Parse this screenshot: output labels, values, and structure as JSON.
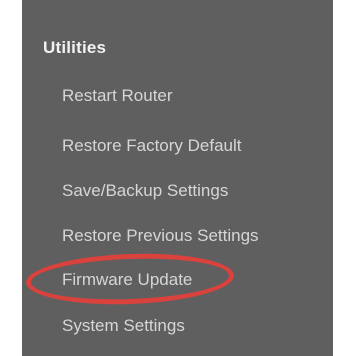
{
  "sidebar": {
    "title": "Utilities",
    "items": [
      {
        "label": "Restart Router"
      },
      {
        "label": "Restore Factory Default"
      },
      {
        "label": "Save/Backup Settings"
      },
      {
        "label": "Restore Previous Settings"
      },
      {
        "label": "Firmware Update",
        "highlighted": true
      },
      {
        "label": "System Settings"
      }
    ]
  },
  "colors": {
    "panel_background": "#5f5f5f",
    "title_text": "#f2f2f2",
    "item_text": "#d6d6d6",
    "highlight_annotation": "#d9423d"
  }
}
